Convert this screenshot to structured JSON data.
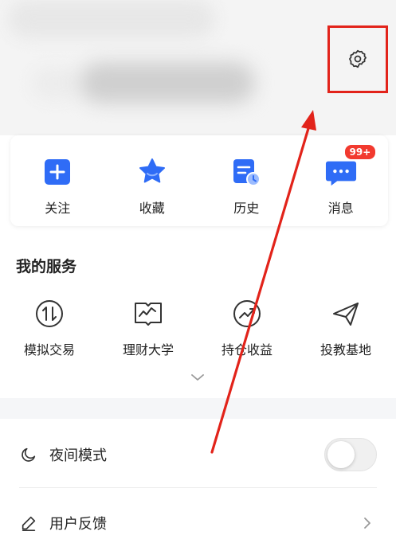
{
  "quick_actions": [
    {
      "label": "关注",
      "icon": "plus-square-icon"
    },
    {
      "label": "收藏",
      "icon": "star-icon"
    },
    {
      "label": "历史",
      "icon": "history-icon"
    },
    {
      "label": "消息",
      "icon": "message-icon",
      "badge": "99+"
    }
  ],
  "services": {
    "title": "我的服务",
    "items": [
      {
        "label": "模拟交易",
        "icon": "trade-icon"
      },
      {
        "label": "理财大学",
        "icon": "book-chart-icon"
      },
      {
        "label": "持仓收益",
        "icon": "trend-icon"
      },
      {
        "label": "投教基地",
        "icon": "paper-plane-icon"
      }
    ]
  },
  "settings_rows": {
    "night_mode": {
      "label": "夜间模式",
      "icon": "moon-icon",
      "enabled": false
    },
    "feedback": {
      "label": "用户反馈",
      "icon": "pen-icon"
    }
  },
  "colors": {
    "accent_blue": "#2f6cf6",
    "highlight_red": "#e2231a",
    "badge_red": "#f23a2f"
  }
}
